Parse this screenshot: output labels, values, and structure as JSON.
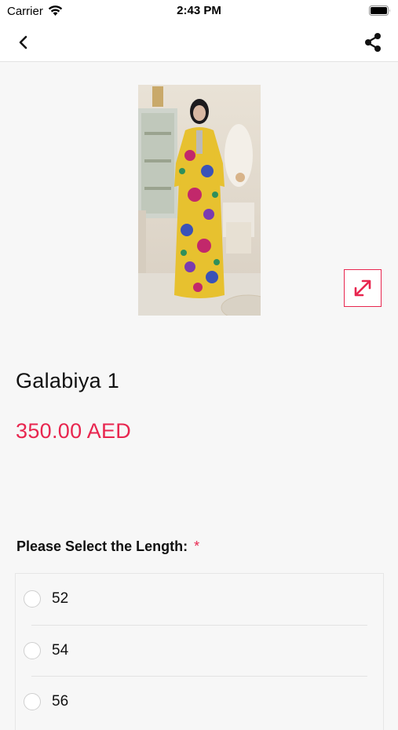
{
  "status_bar": {
    "carrier": "Carrier",
    "time": "2:43 PM",
    "icons": [
      "wifi-icon",
      "battery-icon"
    ]
  },
  "nav": {
    "back_icon": "chevron-left-icon",
    "share_icon": "share-icon"
  },
  "product": {
    "image_alt": "galabiya-dress-photo",
    "title": "Galabiya 1",
    "price": "350.00 AED",
    "expand_icon": "expand-arrows-icon"
  },
  "length_selector": {
    "label": "Please Select the Length:",
    "required_mark": "*",
    "options": [
      {
        "label": "52",
        "selected": false
      },
      {
        "label": "54",
        "selected": false
      },
      {
        "label": "56",
        "selected": false
      }
    ]
  },
  "colors": {
    "accent": "#e8264f",
    "background": "#f7f7f7",
    "text": "#111111"
  }
}
